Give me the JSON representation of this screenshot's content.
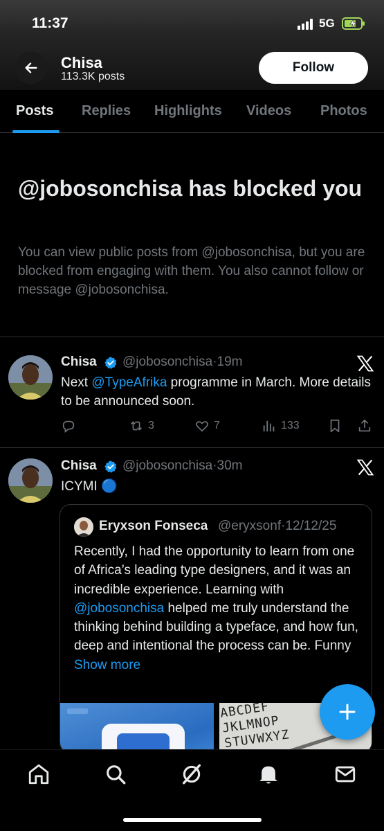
{
  "status_bar": {
    "time": "11:37",
    "network": "5G"
  },
  "header": {
    "name": "Chisa",
    "post_count": "113.3K posts",
    "follow_label": "Follow"
  },
  "tabs": [
    {
      "label": "Posts",
      "active": true
    },
    {
      "label": "Replies",
      "active": false
    },
    {
      "label": "Highlights",
      "active": false
    },
    {
      "label": "Videos",
      "active": false
    },
    {
      "label": "Photos",
      "active": false
    }
  ],
  "blocked": {
    "title": "@jobosonchisa has blocked you",
    "description": "You can view public posts from @jobosonchisa, but you are blocked from engaging with them. You also cannot follow or message @jobosonchisa."
  },
  "posts": [
    {
      "name": "Chisa",
      "handle": "@jobosonchisa",
      "time": "·19m",
      "text_pre": "Next ",
      "text_link": "@TypeAfrika",
      "text_post": " programme in March. More details to be announced soon.",
      "reposts": "3",
      "likes": "7",
      "views": "133"
    },
    {
      "name": "Chisa",
      "handle": "@jobosonchisa",
      "time": "·30m",
      "text": "ICYMI 🔵"
    }
  ],
  "quote": {
    "name": "Eryxson Fonseca",
    "handle": "@eryxsonf",
    "date": "·12/12/25",
    "text_pre": "Recently, I had the opportunity to learn from one of Africa’s leading type designers, and it was an incredible experience. Learning with ",
    "text_link": "@jobosonchisa",
    "text_post": " helped me truly understand the thinking behind building a typeface, and how fun, deep and intentional the process can be. Funny ",
    "show_more": "Show more",
    "image_letters": "ABCDEF\nJKLMNOP\nSTUVWXYZ"
  },
  "colors": {
    "accent": "#1d9bf0",
    "text": "#e7e9ea",
    "muted": "#71767b",
    "divider": "#2f3336"
  },
  "icons": [
    "back-arrow-icon",
    "verified-icon",
    "x-logo-icon",
    "reply-icon",
    "repost-icon",
    "like-icon",
    "views-icon",
    "bookmark-icon",
    "share-icon",
    "compose-icon",
    "home-icon",
    "search-icon",
    "grok-icon",
    "notifications-icon",
    "messages-icon"
  ]
}
